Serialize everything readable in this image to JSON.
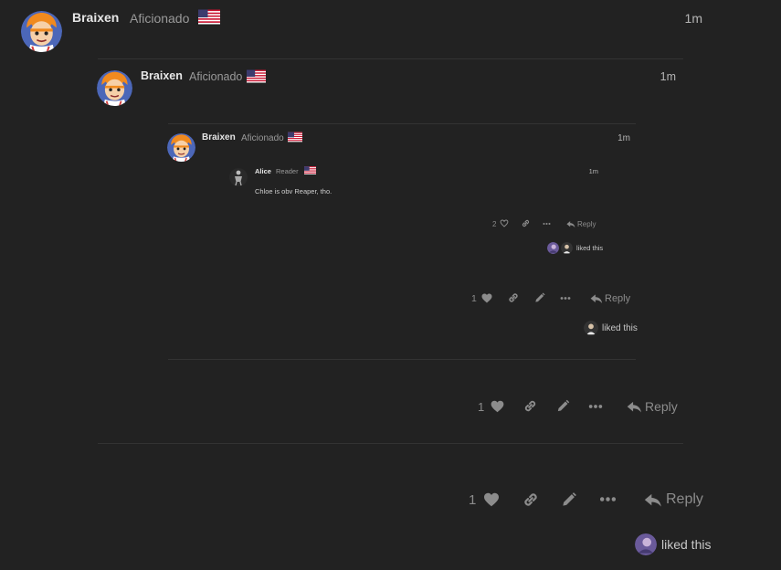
{
  "colors": {
    "background": "#222222",
    "text": "#dddddd",
    "muted": "#8c8c8c",
    "divider": "#333333"
  },
  "level1": {
    "author": "Braixen",
    "user_title": "Aficionado",
    "time": "1m",
    "like_count": "1",
    "reply_label": "Reply",
    "liked_this": "liked this"
  },
  "level2": {
    "author": "Braixen",
    "user_title": "Aficionado",
    "time": "1m",
    "like_count": "1",
    "reply_label": "Reply"
  },
  "level3": {
    "author": "Braixen",
    "user_title": "Aficionado",
    "time": "1m",
    "like_count": "1",
    "reply_label": "Reply",
    "liked_this": "liked this"
  },
  "level4": {
    "author": "Alice",
    "user_title": "Reader",
    "time": "1m",
    "body": "Chloe is obv Reaper, tho.",
    "like_count": "2",
    "reply_label": "Reply",
    "liked_this": "liked this"
  },
  "icons": {
    "flag": "us-flag-icon",
    "heart": "heart-icon",
    "link": "link-icon",
    "edit": "pencil-icon",
    "more": "ellipsis-icon",
    "reply": "reply-arrow-icon"
  }
}
